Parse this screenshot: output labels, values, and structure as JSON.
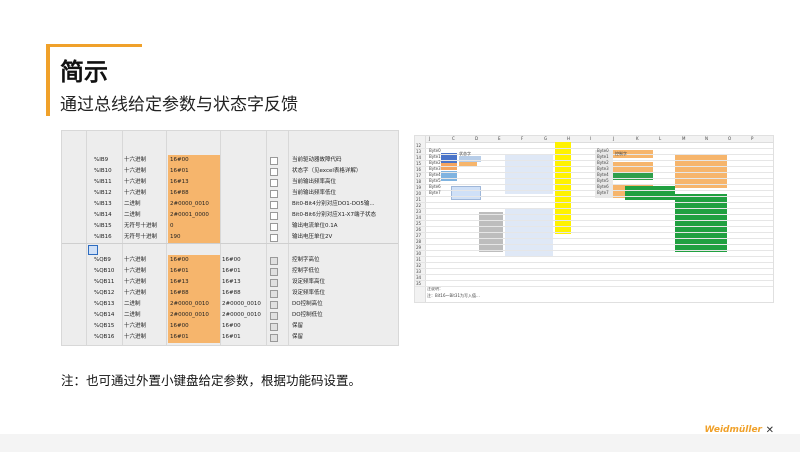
{
  "header": {
    "title": "简示",
    "subtitle": "通过总线给定参数与状态字反馈"
  },
  "left_table": {
    "rows": [
      {
        "addr": "%IB9",
        "type": "十六进制",
        "val": "16#00",
        "val2": "",
        "desc": "当前驱动器故障代码"
      },
      {
        "addr": "%IB10",
        "type": "十六进制",
        "val": "16#01",
        "val2": "",
        "desc": "状态字（见excel表格详解）"
      },
      {
        "addr": "%IB11",
        "type": "十六进制",
        "val": "16#13",
        "val2": "",
        "desc": "当前输出频率高位"
      },
      {
        "addr": "%IB12",
        "type": "十六进制",
        "val": "16#88",
        "val2": "",
        "desc": "当前输出频率低位"
      },
      {
        "addr": "%IB13",
        "type": "二进制",
        "val": "2#0000_0010",
        "val2": "",
        "desc": "Bit0-Bit4分别对应DO1-DO5输..."
      },
      {
        "addr": "%IB14",
        "type": "二进制",
        "val": "2#0001_0000",
        "val2": "",
        "desc": "Bit0-Bit6分别对应X1-X7端子状态"
      },
      {
        "addr": "%IB15",
        "type": "无符号十进制",
        "val": "0",
        "val2": "",
        "desc": "输出电流单位0.1A"
      },
      {
        "addr": "%IB16",
        "type": "无符号十进制",
        "val": "190",
        "val2": "",
        "desc": "输出电压单位2V"
      },
      {
        "addr": "%QB9",
        "type": "十六进制",
        "val": "16#00",
        "val2": "16#00",
        "desc": "控制字高位"
      },
      {
        "addr": "%QB10",
        "type": "十六进制",
        "val": "16#01",
        "val2": "16#01",
        "desc": "控制字低位"
      },
      {
        "addr": "%QB11",
        "type": "十六进制",
        "val": "16#13",
        "val2": "16#13",
        "desc": "设定频率高位"
      },
      {
        "addr": "%QB12",
        "type": "十六进制",
        "val": "16#88",
        "val2": "16#88",
        "desc": "设定频率低位"
      },
      {
        "addr": "%QB13",
        "type": "二进制",
        "val": "2#0000_0010",
        "val2": "2#0000_0010",
        "desc": "DO控制高位"
      },
      {
        "addr": "%QB14",
        "type": "二进制",
        "val": "2#0000_0010",
        "val2": "2#0000_0010",
        "desc": "DO控制低位"
      },
      {
        "addr": "%QB15",
        "type": "十六进制",
        "val": "16#00",
        "val2": "16#00",
        "desc": "保留"
      },
      {
        "addr": "%QB16",
        "type": "十六进制",
        "val": "16#01",
        "val2": "16#01",
        "desc": "保留"
      }
    ]
  },
  "right_sheet": {
    "col_headers": [
      "J",
      "C",
      "D",
      "E",
      "F",
      "G",
      "H",
      "I",
      "J",
      "K",
      "L",
      "M",
      "N",
      "O",
      "P"
    ],
    "row_numbers": [
      "12",
      "13",
      "14",
      "15",
      "16",
      "17",
      "18",
      "19",
      "20",
      "21",
      "22",
      "23",
      "24",
      "25",
      "26",
      "27",
      "28",
      "29",
      "30",
      "31",
      "32",
      "33",
      "34",
      "35"
    ],
    "labels": [
      "Byte0",
      "Byte1",
      "Byte2",
      "Byte3",
      "Byte4",
      "Byte5",
      "Byte6",
      "Byte7"
    ],
    "status_label": "状态字",
    "control_label": "控制字",
    "note_label": "注说明：",
    "bottom_note": "注：Bit16～Bit31为写入值..."
  },
  "note": "注：也可通过外置小键盘给定参数，根据功能码设置。",
  "brand": {
    "logo": "Weidmüller",
    "mark": "✕",
    "accent": "#f0a12a"
  }
}
